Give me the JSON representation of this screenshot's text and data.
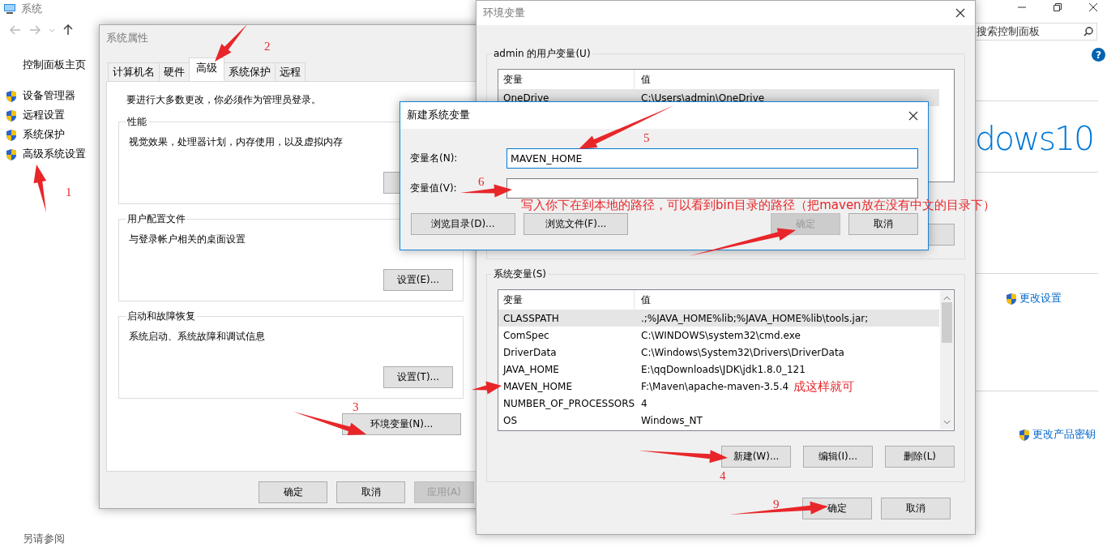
{
  "control_panel": {
    "title": "系统",
    "sidebar": {
      "home": "控制面板主页",
      "items": [
        "设备管理器",
        "远程设置",
        "系统保护",
        "高级系统设置"
      ]
    },
    "search": {
      "placeholder": "搜索控制面板"
    },
    "help": "?",
    "logo_text": "dows10",
    "links": [
      "更改设置",
      "更改产品密钥"
    ],
    "see_also": "另请参阅"
  },
  "system_properties": {
    "title": "系统属性",
    "tabs": [
      {
        "label": "计算机名",
        "selected": false
      },
      {
        "label": "硬件",
        "selected": false
      },
      {
        "label": "高级",
        "selected": true
      },
      {
        "label": "系统保护",
        "selected": false
      },
      {
        "label": "远程",
        "selected": false
      }
    ],
    "admin_note": "要进行大多数更改，你必须作为管理员登录。",
    "groups": [
      {
        "title": "性能",
        "description": "视觉效果，处理器计划，内存使用，以及虚拟内存"
      },
      {
        "title": "用户配置文件",
        "description": "与登录帐户相关的桌面设置",
        "button": "设置(E)..."
      },
      {
        "title": "启动和故障恢复",
        "description": "系统启动、系统故障和调试信息",
        "button": "设置(T)..."
      }
    ],
    "env_button": "环境变量(N)...",
    "buttons": [
      {
        "label": "确定",
        "disabled": false
      },
      {
        "label": "取消",
        "disabled": false
      },
      {
        "label": "应用(A)",
        "disabled": true
      }
    ]
  },
  "environment_variables": {
    "title": "环境变量",
    "user_vars": {
      "title": "admin 的用户变量(U)",
      "columns": [
        "变量",
        "值"
      ],
      "rows": [
        {
          "name": "OneDrive",
          "value": "C:\\Users\\admin\\OneDrive",
          "selected": true
        }
      ]
    },
    "system_vars": {
      "title": "系统变量(S)",
      "columns": [
        "变量",
        "值"
      ],
      "rows": [
        {
          "name": "CLASSPATH",
          "value": ".;%JAVA_HOME%lib;%JAVA_HOME%lib\\tools.jar;",
          "selected": true
        },
        {
          "name": "ComSpec",
          "value": "C:\\WINDOWS\\system32\\cmd.exe",
          "selected": false
        },
        {
          "name": "DriverData",
          "value": "C:\\Windows\\System32\\Drivers\\DriverData",
          "selected": false
        },
        {
          "name": "JAVA_HOME",
          "value": "E:\\qqDownloads\\JDK\\jdk1.8.0_121",
          "selected": false
        },
        {
          "name": "MAVEN_HOME",
          "value": "F:\\Maven\\apache-maven-3.5.4",
          "selected": false
        },
        {
          "name": "NUMBER_OF_PROCESSORS",
          "value": "4",
          "selected": false
        },
        {
          "name": "OS",
          "value": "Windows_NT",
          "selected": false
        }
      ]
    },
    "system_buttons": [
      "新建(W)...",
      "编辑(I)...",
      "删除(L)"
    ],
    "buttons": [
      "确定",
      "取消"
    ]
  },
  "new_variable_dialog": {
    "title": "新建系统变量",
    "name_label": "变量名(N):",
    "name_value": "MAVEN_HOME",
    "value_label": "变量值(V):",
    "buttons": [
      {
        "label": "浏览目录(D)...",
        "disabled": false
      },
      {
        "label": "浏览文件(F)...",
        "disabled": false
      },
      {
        "label": "确定",
        "disabled": true
      },
      {
        "label": "取消",
        "disabled": false
      }
    ]
  },
  "annotations": {
    "step_numbers": [
      "1",
      "2",
      "3",
      "4",
      "5",
      "6",
      "9"
    ],
    "notes": [
      "写入你下在到本地的路径，可以看到bin目录的路径（把maven放在没有中文的目录下）",
      "成这样就可"
    ]
  }
}
